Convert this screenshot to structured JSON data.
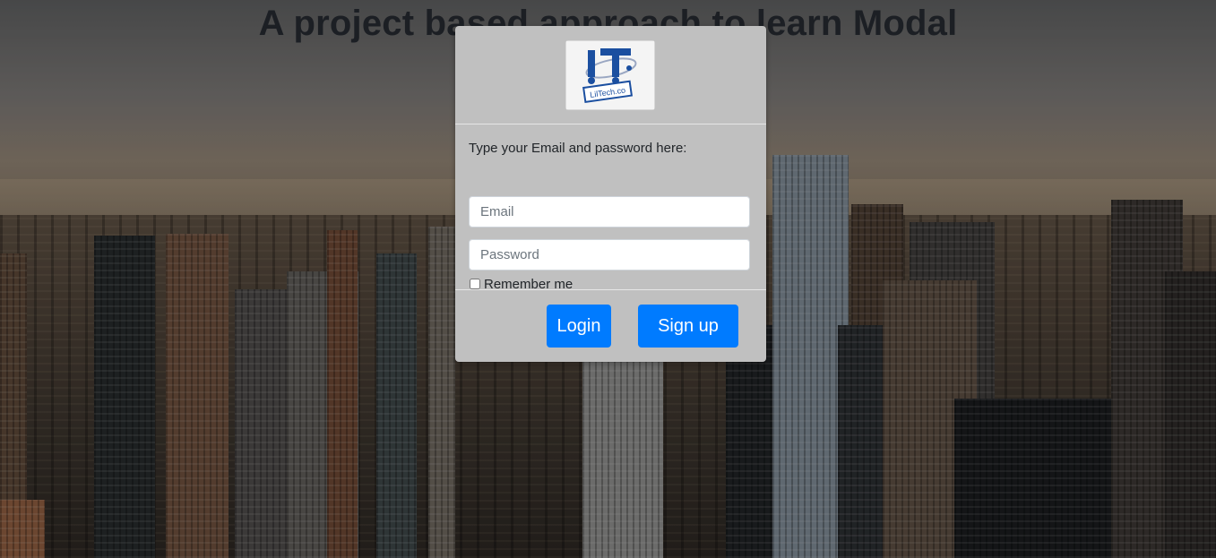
{
  "page": {
    "headline": "A project based approach to learn Modal"
  },
  "modal": {
    "logo_alt": "LilTech.co",
    "logo_letters": "IT",
    "logo_caption": "LilTech.co",
    "prompt": "Type your Email and password here:",
    "email_placeholder": "Email",
    "email_value": "",
    "password_placeholder": "Password",
    "password_value": "",
    "remember_label": "Remember me",
    "remember_checked": false,
    "login_label": "Login",
    "signup_label": "Sign up"
  },
  "colors": {
    "modal_bg": "#c0c0c0",
    "primary_button": "#007bff",
    "headline_text": "#1c1f24"
  }
}
